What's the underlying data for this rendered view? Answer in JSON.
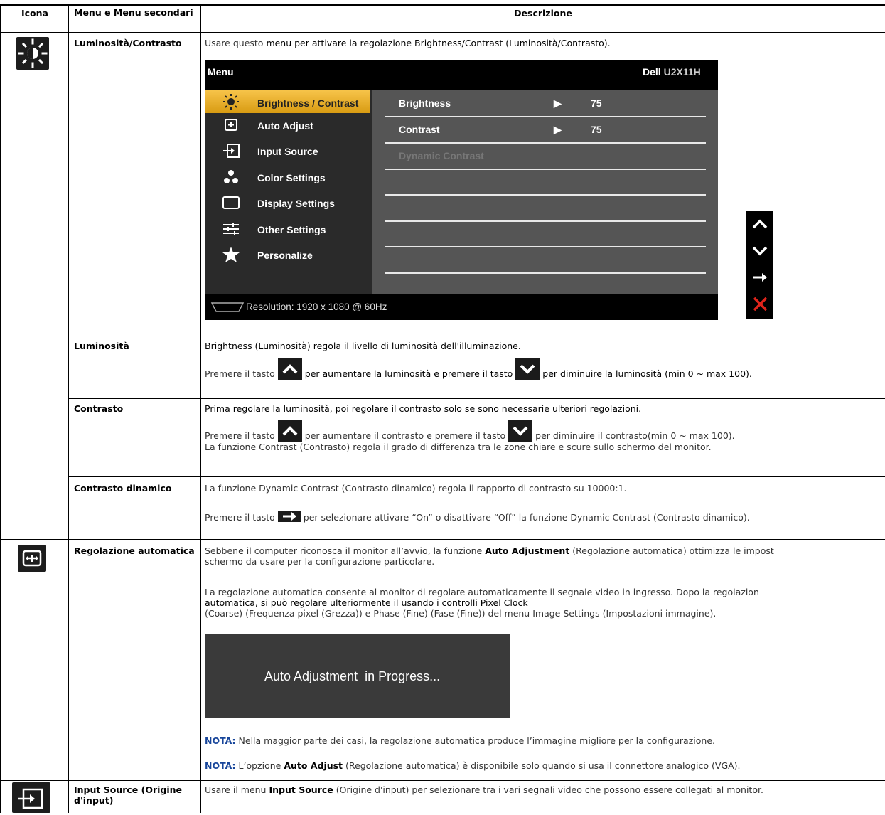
{
  "header": {
    "col1": "Icona",
    "col2": "Menu e Menu secondari",
    "col3": "Descrizione"
  },
  "rows": {
    "luminosita_contrasto": {
      "label_bold": "Luminosità",
      "label_rest": "/Contrasto",
      "desc_prefix": "Usare questo",
      "desc_rest": " menu per attivare la regolazione Brightness/Contrast (Luminosità/Contrasto)."
    },
    "luminosita": {
      "label": "Luminosità",
      "line1": "Brightness (Luminosità) regola il livello di luminosità dell'illuminazione.",
      "line2_a": "Premere il tasto",
      "line2_b": "per aumentare la luminosità e premere il tasto",
      "line2_c": "per diminuire la luminosità (min 0 ~ max 100)."
    },
    "contrasto": {
      "label": "Contrasto",
      "line1": "Prima regolare la luminosità, poi regolare il contrasto solo se sono necessarie ulteriori regolazioni.",
      "line2_a": "Premere il tasto",
      "line2_b": "per aumentare il contrasto e premere il tasto",
      "line2_c": "per diminuire il contrasto(min 0 ~ max 100).",
      "line3": "La funzione Contrast (Contrasto) regola il grado di differenza tra le zone chiare e scure sullo schermo del monitor."
    },
    "contrasto_dinamico": {
      "label": "Contrasto dinamico",
      "line1": "La funzione Dynamic Contrast (Contrasto dinamico) regola il rapporto di contrasto su 10000:1.",
      "line2_a": "Premere il tasto",
      "line2_b": "per selezionare attivare “On” o disattivare “Off” la funzione Dynamic Contrast (Contrasto dinamico)."
    },
    "regolazione_automatica": {
      "label": "Regolazione automatica",
      "p1_a": "Sebbene il computer riconosca il monitor all’avvio, la funzione",
      "p1_bold": "Auto Adjustment",
      "p1_b": "(Regolazione automatica) ottimizza le impost",
      "p1_c": "schermo da usare per la configurazione particolare.",
      "p2_a": "La regolazione automatica consente al monitor di regolare automaticamente il segnale video in ingresso. Dopo la regolazion",
      "p2_b": "automatica, si può regolare ulteriormente il usando i controlli Pixel Clock",
      "p2_c": "(Coarse) (Frequenza pixel (Grezza)) e Phase (Fine) (Fase (Fine)) del menu Image Settings (Impostazioni immagine).",
      "progress_text": "Auto Adjustment  in Progress...",
      "note1_label": "NOTA:",
      "note1_text": " Nella maggior parte dei casi, la regolazione automatica produce l’immagine migliore per la configurazione.",
      "note2_label": "NOTA:",
      "note2_a": " L’opzione ",
      "note2_bold": "Auto Adjust",
      "note2_b": " (Regolazione automatica) è disponibile solo quando si usa il connettore analogico (VGA)."
    },
    "input_source": {
      "label": "Input Source (Origine d'input)",
      "desc_a": "Usare il menu ",
      "desc_bold": "Input Source",
      "desc_b": " (Origine d'input) per selezionare tra i vari segnali video che possono essere collegati al monitor."
    }
  },
  "osd": {
    "title": "Menu",
    "brand": "Dell",
    "model": "U2X11H",
    "menu_items": [
      "Brightness / Contrast",
      "Auto Adjust",
      "Input Source",
      "Color Settings",
      "Display Settings",
      "Other Settings",
      "Personalize"
    ],
    "submenu": [
      {
        "name": "Brightness",
        "value": "75"
      },
      {
        "name": "Contrast",
        "value": "75"
      },
      {
        "name": "Dynamic Contrast",
        "value": ""
      }
    ],
    "resolution": "Resolution: 1920 x 1080 @ 60Hz",
    "selected_index": 0
  },
  "colors": {
    "accent_note": "#17459a",
    "osd_selected": "#f7c44a",
    "exit_red": "#e0241b"
  }
}
